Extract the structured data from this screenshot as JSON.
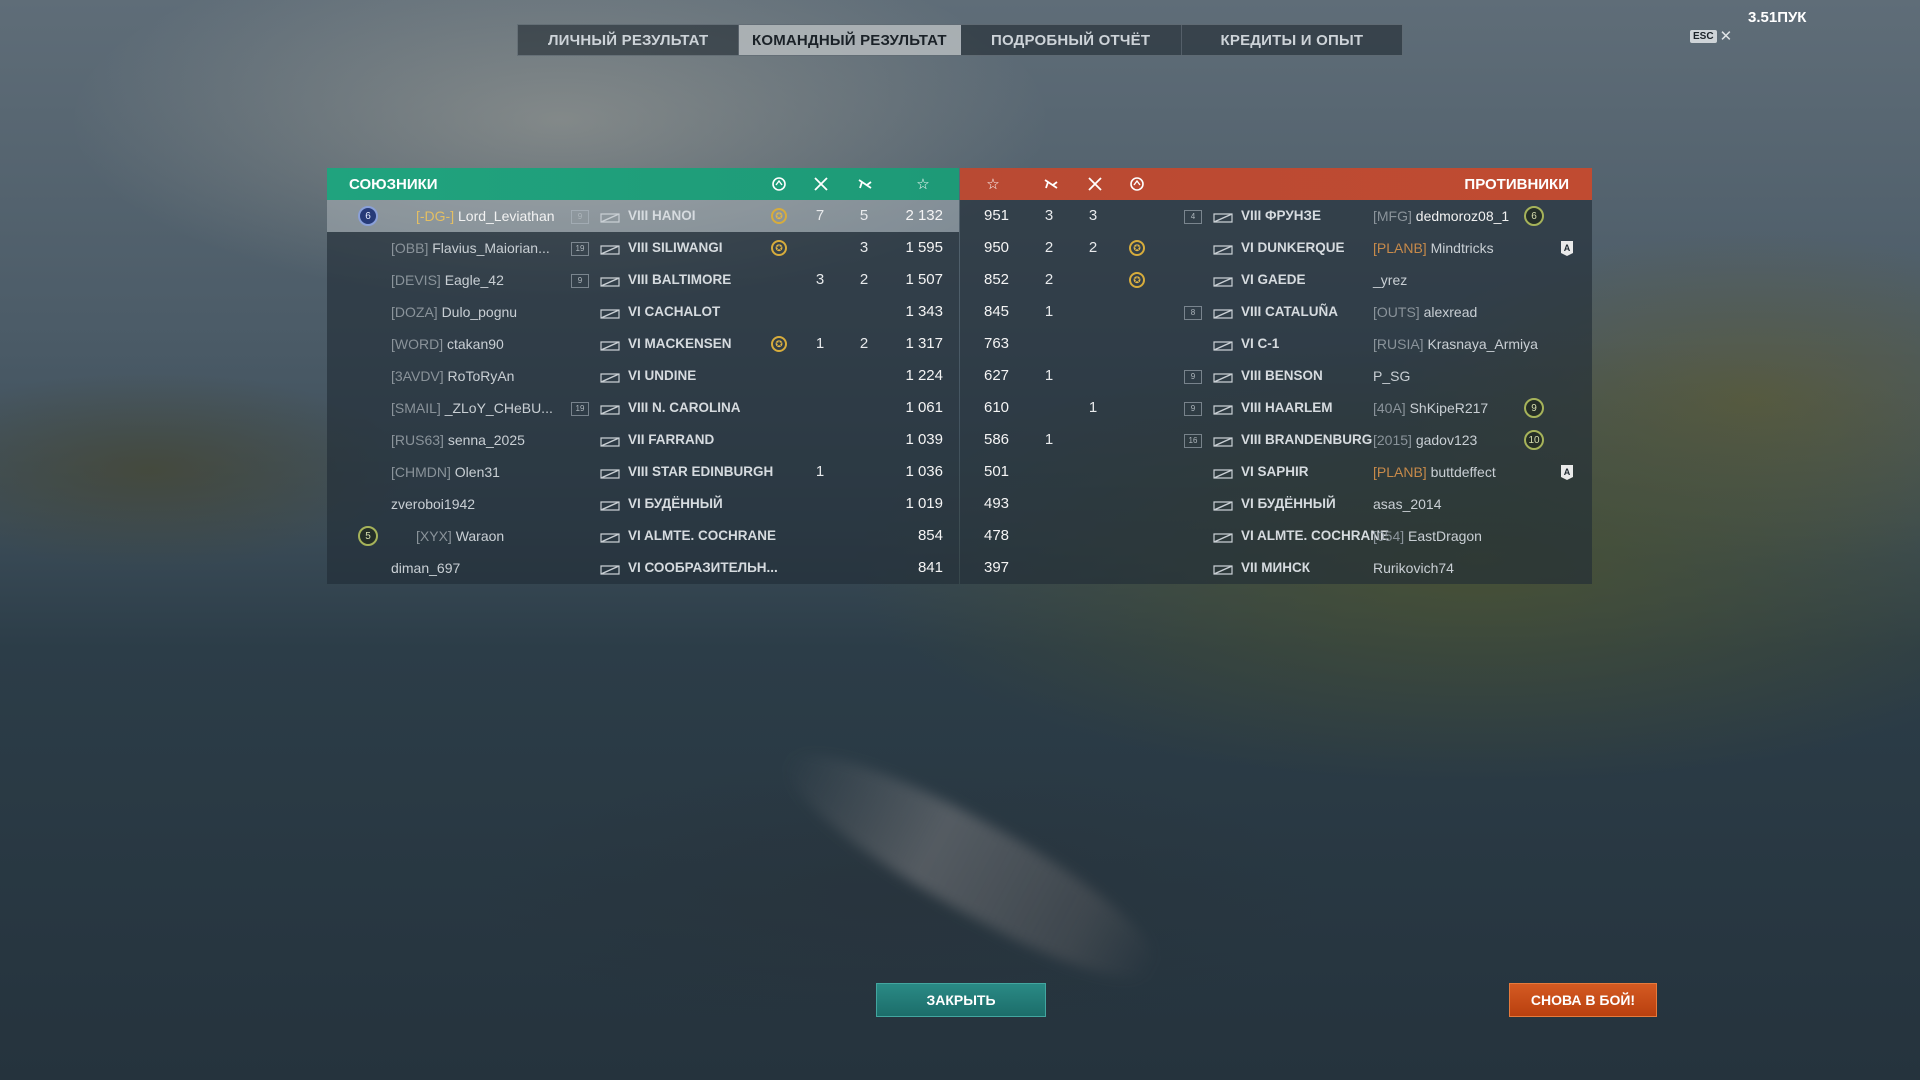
{
  "tabs": [
    {
      "label": "ЛИЧНЫЙ РЕЗУЛЬТАТ",
      "active": false
    },
    {
      "label": "КОМАНДНЫЙ РЕЗУЛЬТАТ",
      "active": true
    },
    {
      "label": "ПОДРОБНЫЙ ОТЧЁТ",
      "active": false
    },
    {
      "label": "КРЕДИТЫ И ОПЫТ",
      "active": false
    }
  ],
  "esc_label": "ESC",
  "clock": "3.51ПУК",
  "allies": {
    "title": "СОЮЗНИКИ",
    "rows": [
      {
        "rank": "6",
        "clan": "[-DG-]",
        "name": "Lord_Leviathan",
        "division": "9",
        "ship": "VIII HANOI",
        "laurel": true,
        "kills": "7",
        "planes": "5",
        "score": "2 132",
        "player": true
      },
      {
        "rank": "",
        "clan": "[OBB]",
        "name": "Flavius_Maiorian...",
        "division": "19",
        "ship": "VIII SILIWANGI",
        "laurel": true,
        "kills": "",
        "planes": "3",
        "score": "1 595"
      },
      {
        "rank": "",
        "clan": "[DEVIS]",
        "name": "Eagle_42",
        "division": "9",
        "ship": "VIII BALTIMORE",
        "laurel": false,
        "kills": "3",
        "planes": "2",
        "score": "1 507"
      },
      {
        "rank": "",
        "clan": "[DOZA]",
        "name": "Dulo_pognu",
        "division": "",
        "ship": "VI CACHALOT",
        "laurel": false,
        "kills": "",
        "planes": "",
        "score": "1 343"
      },
      {
        "rank": "",
        "clan": "[WORD]",
        "name": "ctakan90",
        "division": "",
        "ship": "VI MACKENSEN",
        "laurel": true,
        "kills": "1",
        "planes": "2",
        "score": "1 317"
      },
      {
        "rank": "",
        "clan": "[3AVDV]",
        "name": "RoToRyAn",
        "division": "",
        "ship": "VI UNDINE",
        "laurel": false,
        "kills": "",
        "planes": "",
        "score": "1 224"
      },
      {
        "rank": "",
        "clan": "[SMAIL]",
        "name": "_ZLoY_CHeBU...",
        "division": "19",
        "ship": "VIII N. CAROLINA",
        "laurel": false,
        "kills": "",
        "planes": "",
        "score": "1 061"
      },
      {
        "rank": "",
        "clan": "[RUS63]",
        "name": "senna_2025",
        "division": "",
        "ship": "VII FARRAND",
        "laurel": false,
        "kills": "",
        "planes": "",
        "score": "1 039"
      },
      {
        "rank": "",
        "clan": "[CHMDN]",
        "name": "Olen31",
        "division": "",
        "ship": "VIII STAR EDINBURGH",
        "laurel": false,
        "kills": "1",
        "planes": "",
        "score": "1 036"
      },
      {
        "rank": "",
        "clan": "",
        "name": "zveroboi1942",
        "division": "",
        "ship": "VI БУДЁННЫЙ",
        "laurel": false,
        "kills": "",
        "planes": "",
        "score": "1 019"
      },
      {
        "rank": "5",
        "clan": "[XYX]",
        "name": "Waraon",
        "division": "",
        "ship": "VI ALMTE. COCHRANE",
        "laurel": false,
        "kills": "",
        "planes": "",
        "score": "854"
      },
      {
        "rank": "",
        "clan": "",
        "name": "diman_697",
        "division": "",
        "ship": "VI СООБРАЗИТЕЛЬН...",
        "laurel": false,
        "kills": "",
        "planes": "",
        "score": "841"
      }
    ]
  },
  "enemies": {
    "title": "ПРОТИВНИКИ",
    "rows": [
      {
        "score": "951",
        "planes": "3",
        "kills": "3",
        "laurel": false,
        "division": "4",
        "ship": "VIII ФРУНЗЕ",
        "clan": "[MFG]",
        "name": "dedmoroz08_1",
        "rank": "6",
        "badge": ""
      },
      {
        "score": "950",
        "planes": "2",
        "kills": "2",
        "laurel": true,
        "division": "",
        "ship": "VI DUNKERQUE",
        "clan": "[PLANB]",
        "name": "Mindtricks",
        "rank": "",
        "badge": "A"
      },
      {
        "score": "852",
        "planes": "2",
        "kills": "",
        "laurel": true,
        "division": "",
        "ship": "VI GAEDE",
        "clan": "",
        "name": "_yrez",
        "rank": "",
        "badge": ""
      },
      {
        "score": "845",
        "planes": "1",
        "kills": "",
        "laurel": false,
        "division": "8",
        "ship": "VIII CATALUÑA",
        "clan": "[OUTS]",
        "name": "alexread",
        "rank": "",
        "badge": ""
      },
      {
        "score": "763",
        "planes": "",
        "kills": "",
        "laurel": false,
        "division": "",
        "ship": "VI C-1",
        "clan": "[RUSIA]",
        "name": "Krasnaya_Armiya",
        "rank": "",
        "badge": ""
      },
      {
        "score": "627",
        "planes": "1",
        "kills": "",
        "laurel": false,
        "division": "9",
        "ship": "VIII BENSON",
        "clan": "",
        "name": "P_SG",
        "rank": "",
        "badge": ""
      },
      {
        "score": "610",
        "planes": "",
        "kills": "1",
        "laurel": false,
        "division": "9",
        "ship": "VIII HAARLEM",
        "clan": "[40A]",
        "name": "ShKipeR217",
        "rank": "9",
        "badge": ""
      },
      {
        "score": "586",
        "planes": "1",
        "kills": "",
        "laurel": false,
        "division": "16",
        "ship": "VIII BRANDENBURG",
        "clan": "[2015]",
        "name": "gadov123",
        "rank": "10",
        "badge": ""
      },
      {
        "score": "501",
        "planes": "",
        "kills": "",
        "laurel": false,
        "division": "",
        "ship": "VI SAPHIR",
        "clan": "[PLANB]",
        "name": "buttdeffect",
        "rank": "",
        "badge": "A"
      },
      {
        "score": "493",
        "planes": "",
        "kills": "",
        "laurel": false,
        "division": "",
        "ship": "VI БУДЁННЫЙ",
        "clan": "",
        "name": "asas_2014",
        "rank": "",
        "badge": ""
      },
      {
        "score": "478",
        "planes": "",
        "kills": "",
        "laurel": false,
        "division": "",
        "ship": "VI ALMTE. COCHRANE",
        "clan": "[054]",
        "name": "EastDragon",
        "rank": "",
        "badge": ""
      },
      {
        "score": "397",
        "planes": "",
        "kills": "",
        "laurel": false,
        "division": "",
        "ship": "VII МИНСК",
        "clan": "",
        "name": "Rurikovich74",
        "rank": "",
        "badge": ""
      }
    ]
  },
  "buttons": {
    "close": "ЗАКРЫТЬ",
    "battle": "СНОВА В БОЙ!"
  },
  "icons": {
    "laurel": "laurel-wreath-icon",
    "kills": "crossed-swords-icon",
    "planes": "plane-icon",
    "score": "star-icon"
  },
  "colors": {
    "allies": "#20a37e",
    "enemies": "#c04b31",
    "close_button": "#1f7a76",
    "battle_button": "#c94c17"
  }
}
